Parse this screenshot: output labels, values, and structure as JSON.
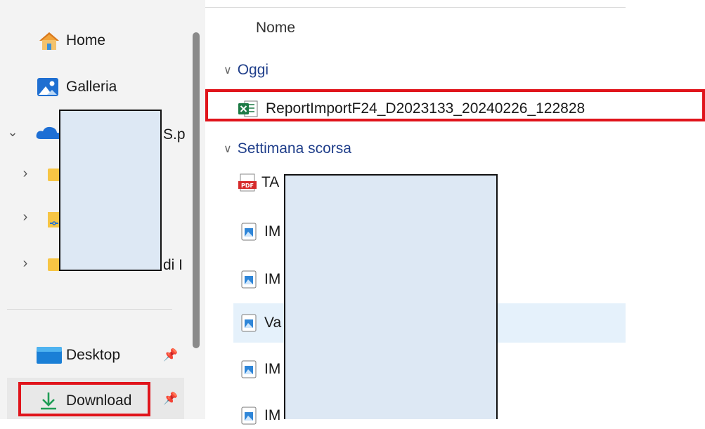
{
  "sidebar": {
    "quick": [
      {
        "label": "Home",
        "icon": "home-icon"
      },
      {
        "label": "Galleria",
        "icon": "gallery-icon"
      }
    ],
    "onedrive_fragment": "S.p",
    "tree_fragment": "di I",
    "pinned": [
      {
        "label": "Desktop",
        "icon": "desktop-folder-icon",
        "pinned": true
      },
      {
        "label": "Download",
        "icon": "download-icon",
        "pinned": true
      }
    ]
  },
  "main": {
    "column_header": "Nome",
    "groups": [
      {
        "label": "Oggi"
      },
      {
        "label": "Settimana scorsa"
      }
    ],
    "today_file": "ReportImportF24_D2023133_20240226_122828",
    "week_files": [
      {
        "text": "TA",
        "icon": "pdf-icon"
      },
      {
        "text": "IM",
        "icon": "image-file-icon"
      },
      {
        "text": "IM",
        "icon": "image-file-icon"
      },
      {
        "text": "Va",
        "icon": "image-file-icon",
        "selected": true
      },
      {
        "text": "IM",
        "icon": "image-file-icon"
      },
      {
        "text": "IM",
        "icon": "image-file-icon"
      }
    ]
  },
  "colors": {
    "sidebar_bg": "#f3f3f3",
    "group_header": "#1f3e8a",
    "highlight_red": "#e0141b",
    "selection_bg": "#e5f1fb",
    "redaction_fill": "#dde8f4"
  }
}
